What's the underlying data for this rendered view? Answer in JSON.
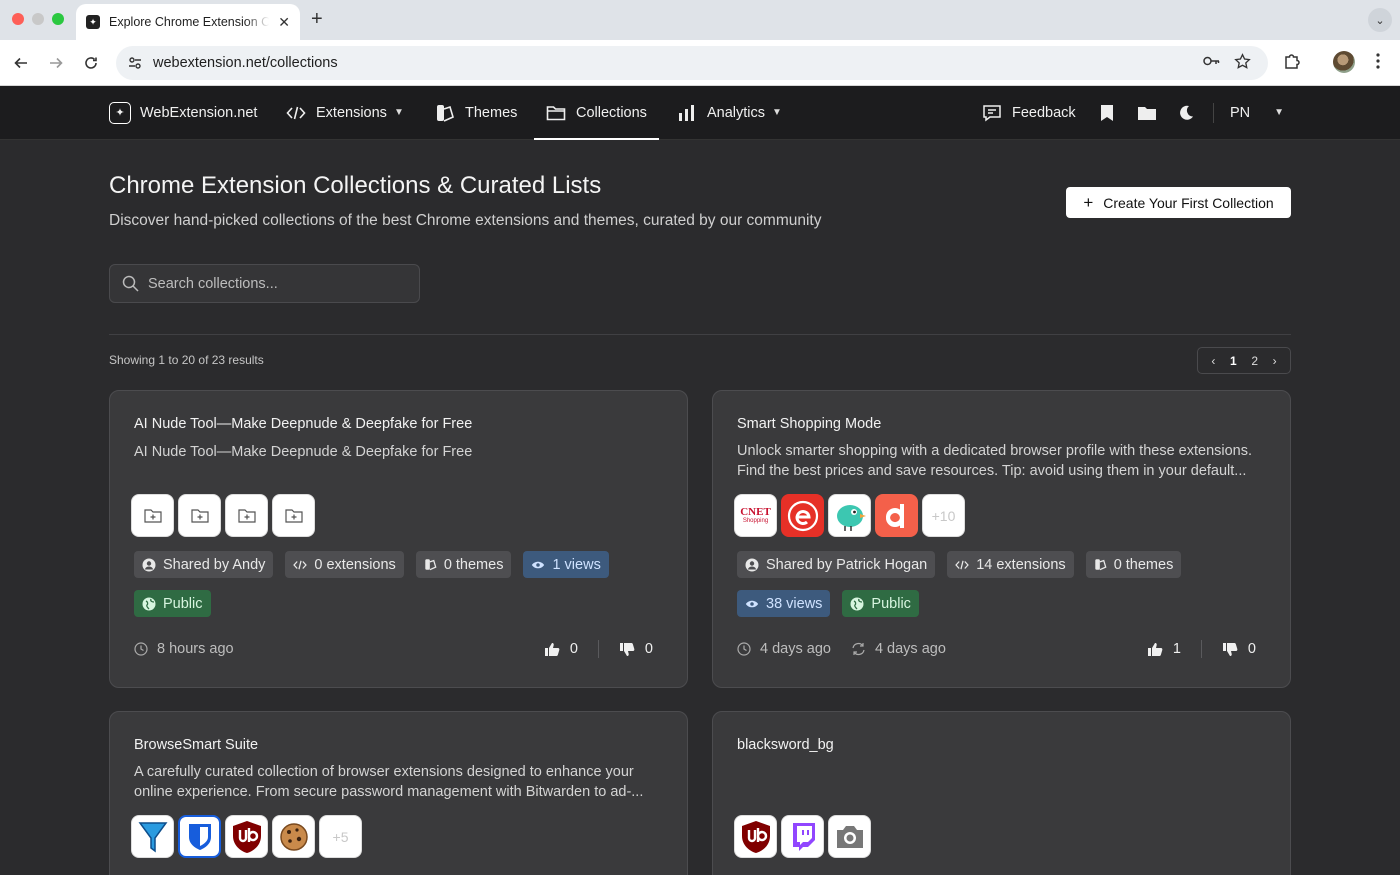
{
  "browser": {
    "tab_title": "Explore Chrome Extension Collections",
    "url": "webextension.net/collections"
  },
  "nav": {
    "brand": "WebExtension.net",
    "extensions": "Extensions",
    "themes": "Themes",
    "collections": "Collections",
    "analytics": "Analytics",
    "feedback": "Feedback",
    "lang": "PN"
  },
  "header": {
    "title": "Chrome Extension Collections & Curated Lists",
    "subtitle": "Discover hand-picked collections of the best Chrome extensions and themes, curated by our community",
    "create_button": "Create Your First Collection"
  },
  "search": {
    "placeholder": "Search collections..."
  },
  "results": {
    "summary": "Showing 1 to 20 of 23 results"
  },
  "pagination": {
    "pages": [
      "1",
      "2"
    ]
  },
  "cards": [
    {
      "title": "AI Nude Tool—Make Deepnude & Deepfake for Free",
      "description": "AI Nude Tool—Make Deepnude & Deepfake for Free",
      "shared_by": "Shared by Andy",
      "extensions": "0 extensions",
      "themes": "0 themes",
      "views": "1 views",
      "visibility": "Public",
      "created": "8 hours ago",
      "upvotes": "0",
      "downvotes": "0"
    },
    {
      "title": "Smart Shopping Mode",
      "description": "Unlock smarter shopping with a dedicated browser profile with these extensions. Find the best prices and save resources. Tip: avoid using them in your default...",
      "more_icons": "+10",
      "shared_by": "Shared by Patrick Hogan",
      "extensions": "14 extensions",
      "themes": "0 themes",
      "views": "38 views",
      "visibility": "Public",
      "created": "4 days ago",
      "updated": "4 days ago",
      "upvotes": "1",
      "downvotes": "0",
      "icon_labels": {
        "cnet": "CNET",
        "cnet_sub": "Shopping"
      }
    },
    {
      "title": "BrowseSmart Suite",
      "description": "A carefully curated collection of browser extensions designed to enhance your online experience. From secure password management with Bitwarden to ad-...",
      "more_icons": "+5"
    },
    {
      "title": "blacksword_bg",
      "description": ""
    }
  ],
  "colors": {
    "page_bg": "#2b2b2d",
    "card_bg": "#3a3a3c",
    "views_badge": "#3d5a7d",
    "public_badge": "#2f6b43"
  }
}
